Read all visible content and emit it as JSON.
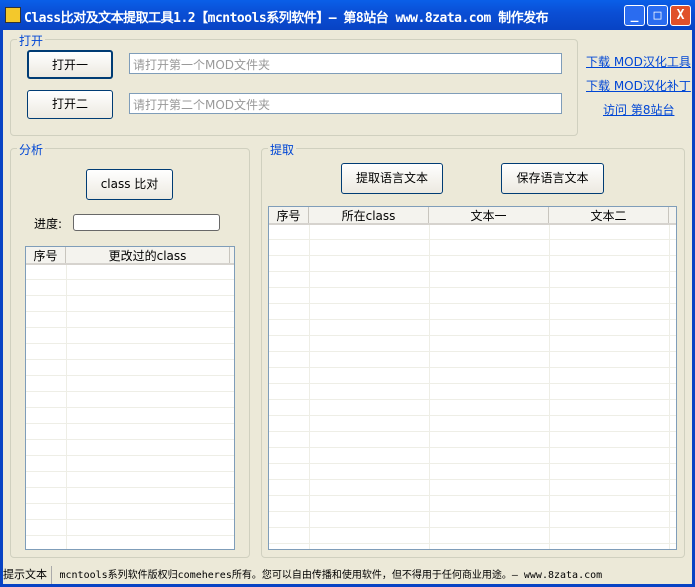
{
  "window": {
    "title": "Class比对及文本提取工具1.2【mcntools系列软件】— 第8站台 www.8zata.com 制作发布",
    "minimize": "_",
    "maximize": "□",
    "close": "X"
  },
  "open": {
    "label": "打开",
    "btn1": "打开一",
    "btn2": "打开二",
    "input1_placeholder": "请打开第一个MOD文件夹",
    "input2_placeholder": "请打开第二个MOD文件夹"
  },
  "links": [
    "下载 MOD汉化工具",
    "下载 MOD汉化补丁",
    "访问 第8站台"
  ],
  "analysis": {
    "label": "分析",
    "compare_btn": "class 比对",
    "progress_label": "进度:",
    "progress": 0,
    "columns": [
      "序号",
      "更改过的class"
    ]
  },
  "extract": {
    "label": "提取",
    "extract_btn": "提取语言文本",
    "save_btn": "保存语言文本",
    "columns": [
      "序号",
      "所在class",
      "文本一",
      "文本二"
    ]
  },
  "status": {
    "label": "提示文本",
    "text": "mcntools系列软件版权归comeheres所有。您可以自由传播和使用软件，但不得用于任何商业用途。— www.8zata.com"
  }
}
